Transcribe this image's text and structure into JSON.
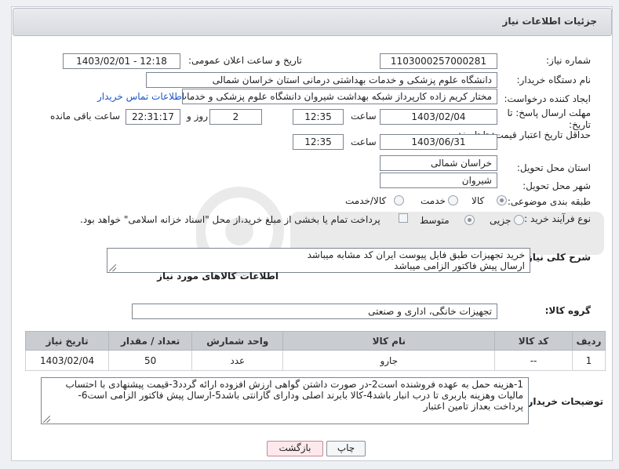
{
  "header": {
    "title": "جزئیات اطلاعات نیاز"
  },
  "form": {
    "need_number_label": "شماره نیاز:",
    "need_number": "1103000257000281",
    "announce_label": "تاریخ و ساعت اعلان عمومی:",
    "announce_value": "1403/02/01 - 12:18",
    "buyer_org_label": "نام دستگاه خریدار:",
    "buyer_org": "دانشگاه علوم پزشکی و خدمات بهداشتی درمانی استان خراسان شمالی",
    "requester_label": "ایجاد کننده درخواست:",
    "requester": "مختار کریم زاده کارپرداز شبکه بهداشت شیروان دانشگاه علوم پزشکی و خدمات",
    "contact_link": "اطلاعات تماس خریدار",
    "reply_deadline_label": "مهلت ارسال پاسخ: تا تاریخ:",
    "reply_date": "1403/02/04",
    "time_label": "ساعت",
    "reply_time": "12:35",
    "days_value": "2",
    "days_label": "روز و",
    "remaining_time": "22:31:17",
    "remaining_label": "ساعت باقی مانده",
    "price_validity_label": "حداقل تاریخ اعتبار قیمت: تا تاریخ:",
    "price_date": "1403/06/31",
    "price_time": "12:35",
    "province_label": "استان محل تحویل:",
    "province": "خراسان شمالی",
    "city_label": "شهر محل تحویل:",
    "city": "شیروان",
    "category_label": "طبقه بندی موضوعی:",
    "category_options": [
      "کالا",
      "خدمت",
      "کالا/خدمت"
    ],
    "category_selected": "کالا",
    "process_label": "نوع فرآیند خرید :",
    "process_options": [
      "جزیی",
      "متوسط"
    ],
    "process_selected": "جزیی",
    "treasury_note": "پرداخت تمام یا بخشی از مبلغ خرید،از محل \"اسناد خزانه اسلامی\" خواهد بود."
  },
  "description": {
    "label": "شرح کلی نیاز:",
    "lines": [
      "خرید تجهیزات طبق فایل پیوست ایران کد مشابه میباشد",
      "ارسال پیش فاکتور الزامی میباشد"
    ]
  },
  "goods": {
    "section_title": "اطلاعات کالاهای مورد نیاز",
    "group_label": "گروه کالا:",
    "group_value": "تجهیزات خانگی، اداری و صنعتی",
    "columns": [
      "ردیف",
      "کد کالا",
      "نام کالا",
      "واحد شمارش",
      "تعداد / مقدار",
      "تاریخ نیاز"
    ],
    "rows": [
      {
        "row": "1",
        "code": "--",
        "name": "جارو",
        "unit": "عدد",
        "qty": "50",
        "date": "1403/02/04"
      }
    ]
  },
  "buyer_notes": {
    "label": "توضیحات خریدار:",
    "text": "1-هزینه حمل به عهده فروشنده است2-در صورت داشتن گواهی ارزش افزوده ارائه گردد3-قیمت پیشنهادی با احتساب مالیات وهزینه باربری تا درب انبار  باشد4-کالا بابرند اصلی ودارای گارانتی باشد5-ارسال پیش فاکتور الزامی است6- پرداخت بعداز تامین اعتبار"
  },
  "buttons": {
    "print": "چاپ",
    "back": "بازگشت"
  },
  "colors": {
    "table_header": "#c9ccd1",
    "link": "#1a56c8",
    "back_button": "#fde8ec"
  }
}
